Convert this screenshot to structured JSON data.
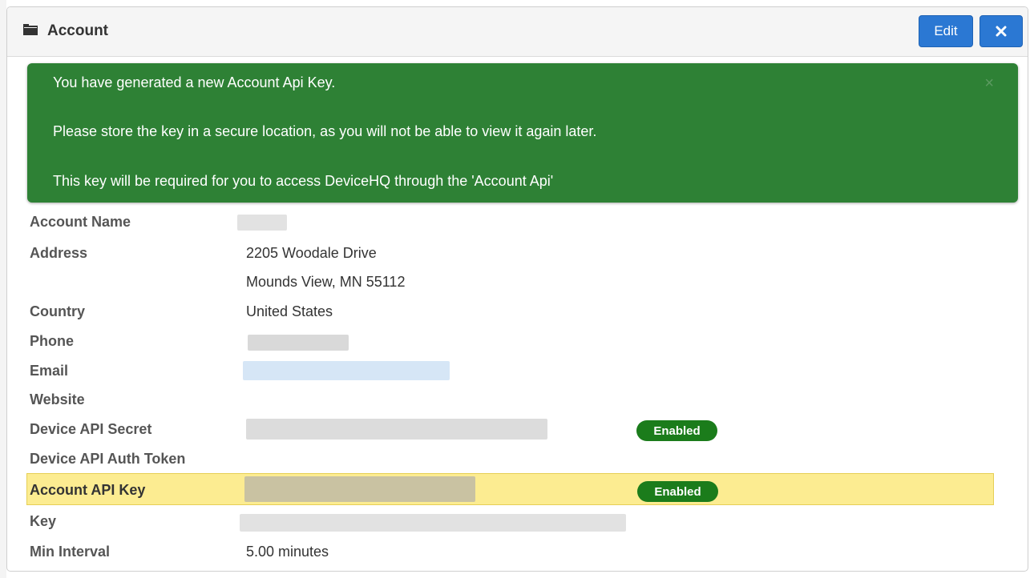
{
  "panel": {
    "title": "Account",
    "edit_label": "Edit",
    "close_icon": "close-icon",
    "header_icon": "folder-icon"
  },
  "alert": {
    "line1": "You have generated a new Account Api Key.",
    "line2": "Please store the key in a secure location, as you will not be able to view it again later.",
    "line3": "This key will be required for you to access DeviceHQ through the 'Account Api'",
    "close_label": "×"
  },
  "fields": {
    "account_name": {
      "label": "Account Name"
    },
    "address": {
      "label": "Address",
      "line1": "2205 Woodale Drive",
      "line2": "Mounds View, MN 55112"
    },
    "country": {
      "label": "Country",
      "value": "United States"
    },
    "phone": {
      "label": "Phone"
    },
    "email": {
      "label": "Email"
    },
    "website": {
      "label": "Website"
    },
    "device_api_secret": {
      "label": "Device API Secret",
      "status": "Enabled"
    },
    "device_api_auth_token": {
      "label": "Device API Auth Token"
    },
    "account_api_key": {
      "label": "Account API Key",
      "status": "Enabled"
    },
    "key": {
      "label": "Key"
    },
    "min_interval": {
      "label": "Min Interval",
      "value": "5.00 minutes"
    }
  },
  "colors": {
    "primary_button": "#2b78d3",
    "alert_success": "#2e8135",
    "badge_enabled": "#1b7c1b",
    "row_highlight": "#fcec91"
  }
}
